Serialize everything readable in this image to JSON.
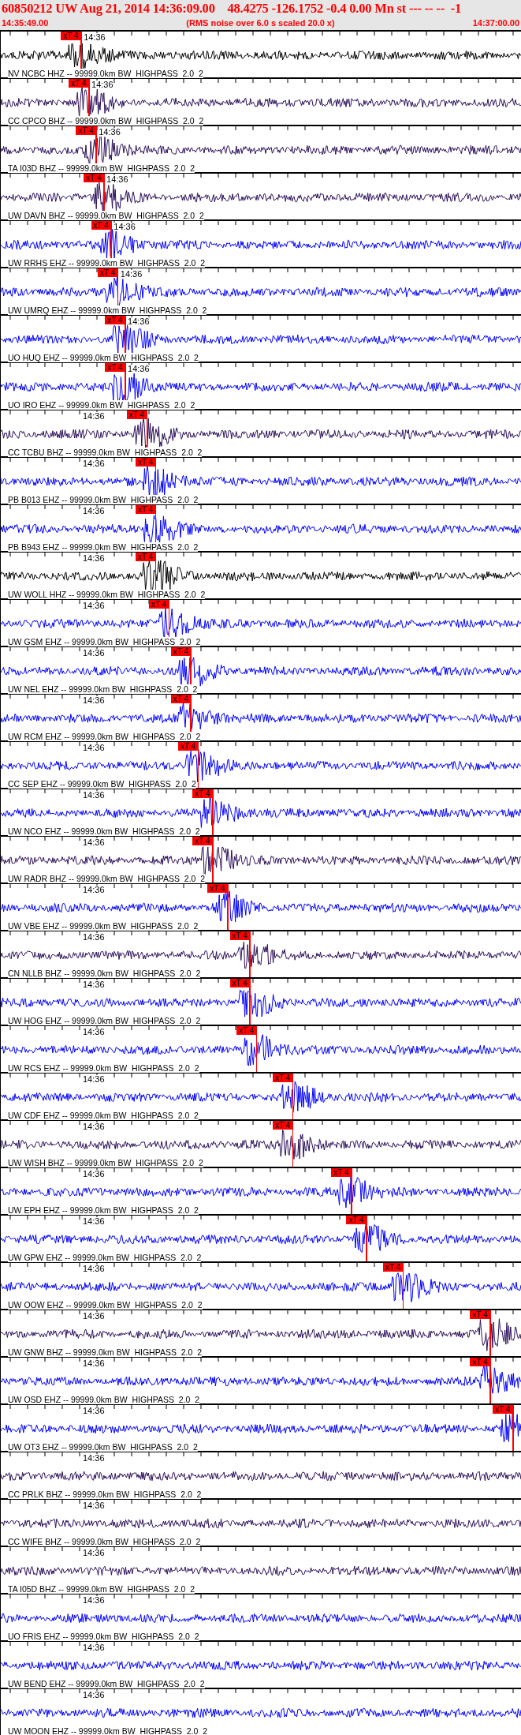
{
  "header": {
    "title": "60850212 UW Aug 21, 2014 14:36:09.00    48.4275 -126.1752 -0.4 0.00 Mn st --- -- --  -1",
    "start_time": "14:35:49.00",
    "note": "(RMS noise over 6.0 s scaled 20.0 x)",
    "end_time": "14:37:00.00"
  },
  "channels": [
    {
      "label": "NV NCBC HHZ -- 99999.0km BW  HIGHPASS  2.0  2",
      "time_label": "14:36",
      "color": "#000000",
      "pick": {
        "label": "xT 4",
        "level": 0.154
      }
    },
    {
      "label": "CC CPCO BHZ -- 99999.0km BW  HIGHPASS  2.0  2",
      "time_label": "14:36",
      "color": "#2b0f5a",
      "pick": {
        "label": "xT 4",
        "level": 0.169
      }
    },
    {
      "label": "TA I03D BHZ -- 99999.0km BW  HIGHPASS  2.0  2",
      "time_label": "14:36",
      "color": "#2b0f5a",
      "pick": {
        "label": "xT 4",
        "level": 0.183
      }
    },
    {
      "label": "UW DAVN BHZ -- 99999.0km BW  HIGHPASS  2.0  2",
      "time_label": "14:36",
      "color": "#2b0f5a",
      "pick": {
        "label": "xT 4",
        "level": 0.198
      }
    },
    {
      "label": "UW RRHS EHZ -- 99999.0km BW  HIGHPASS  2.0  2",
      "time_label": "14:36",
      "color": "#0000ff",
      "pick": {
        "label": "xT 4",
        "level": 0.212
      }
    },
    {
      "label": "UW UMRQ EHZ -- 99999.0km BW  HIGHPASS  2.0  2",
      "time_label": "14:36",
      "color": "#0000ff",
      "pick": {
        "label": "xT 4",
        "level": 0.225
      }
    },
    {
      "label": "UO HUQ EHZ -- 99999.0km BW  HIGHPASS  2.0  2",
      "time_label": "14:36",
      "color": "#0000ff",
      "pick": {
        "label": "xT 4",
        "level": 0.239
      }
    },
    {
      "label": "UO IRO EHZ -- 99999.0km BW  HIGHPASS  2.0  2",
      "time_label": "14:36",
      "color": "#0000ff",
      "pick": {
        "label": "xT 4",
        "level": 0.239
      }
    },
    {
      "label": "CC TCBU BHZ -- 99999.0km BW  HIGHPASS  2.0  2",
      "time_label": "14:36",
      "color": "#2b0f5a",
      "pick": {
        "label": "xT 4",
        "level": 0.281
      }
    },
    {
      "label": "PB B013 EHZ -- 99999.0km BW  HIGHPASS  2.0  2",
      "time_label": "14:36",
      "color": "#0000ff",
      "pick": {
        "label": "xT 4",
        "level": 0.298
      }
    },
    {
      "label": "PB B943 EHZ -- 99999.0km BW  HIGHPASS  2.0  2",
      "time_label": "14:36",
      "color": "#0000ff",
      "pick": {
        "label": "xT 4",
        "level": 0.298
      }
    },
    {
      "label": "UW WOLL HHZ -- 99999.0km BW  HIGHPASS  2.0  2",
      "time_label": "14:36",
      "color": "#000000",
      "pick": {
        "label": "xT 4",
        "level": 0.298
      }
    },
    {
      "label": "UW GSM EHZ -- 99999.0km BW  HIGHPASS  2.0  2",
      "time_label": "14:36",
      "color": "#0000ff",
      "pick": {
        "label": "xT 4",
        "level": 0.324
      }
    },
    {
      "label": "UW NEL EHZ -- 99999.0km BW  HIGHPASS  2.0  2",
      "time_label": "14:36",
      "color": "#0000ff",
      "pick": {
        "label": "xT 4",
        "level": 0.366
      }
    },
    {
      "label": "UW RCM EHZ -- 99999.0km BW  HIGHPASS  2.0  2",
      "time_label": "14:36",
      "color": "#0000ff",
      "pick": {
        "label": "xT 4",
        "level": 0.366
      }
    },
    {
      "label": "CC SEP EHZ -- 99999.0km BW  HIGHPASS  2.0  2",
      "time_label": "14:36",
      "color": "#0000ff",
      "pick": {
        "label": "xT 4",
        "level": 0.38
      }
    },
    {
      "label": "UW NCO EHZ -- 99999.0km BW  HIGHPASS  2.0  2",
      "time_label": "14:36",
      "color": "#0000ff",
      "pick": {
        "label": "xT 4",
        "level": 0.408
      }
    },
    {
      "label": "UW RADR BHZ -- 99999.0km BW  HIGHPASS  2.0  2",
      "time_label": "14:36",
      "color": "#2b0f5a",
      "pick": {
        "label": "xT 4",
        "level": 0.408
      }
    },
    {
      "label": "UW VBE EHZ -- 99999.0km BW  HIGHPASS  2.0  2",
      "time_label": "14:36",
      "color": "#0000ff",
      "pick": {
        "label": "xT 4",
        "level": 0.437
      }
    },
    {
      "label": "CN NLLB BHZ -- 99999.0km BW  HIGHPASS  2.0  2",
      "time_label": "14:36",
      "color": "#2b0f5a",
      "pick": {
        "label": "xT 4",
        "level": 0.48
      }
    },
    {
      "label": "UW HOG EHZ -- 99999.0km BW  HIGHPASS  2.0  2",
      "time_label": "14:36",
      "color": "#0000ff",
      "pick": {
        "label": "xT 4",
        "level": 0.48
      }
    },
    {
      "label": "UW RCS EHZ -- 99999.0km BW  HIGHPASS  2.0  2",
      "time_label": "14:36",
      "color": "#0000ff",
      "pick": {
        "label": "xT 4",
        "level": 0.493
      }
    },
    {
      "label": "UW CDF EHZ -- 99999.0km BW  HIGHPASS  2.0  2",
      "time_label": "14:36",
      "color": "#0000ff",
      "pick": {
        "label": "xT 4",
        "level": 0.563
      }
    },
    {
      "label": "UW WISH BHZ -- 99999.0km BW  HIGHPASS  2.0  2",
      "time_label": "14:36",
      "color": "#2b0f5a",
      "pick": {
        "label": "xT 4",
        "level": 0.563
      }
    },
    {
      "label": "UW EPH EHZ -- 99999.0km BW  HIGHPASS  2.0  2",
      "time_label": "14:36",
      "color": "#0000ff",
      "pick": {
        "label": "xT 4",
        "level": 0.676
      }
    },
    {
      "label": "UW GPW EHZ -- 99999.0km BW  HIGHPASS  2.0  2",
      "time_label": "14:36",
      "color": "#0000ff",
      "pick": {
        "label": "xT 4",
        "level": 0.705
      }
    },
    {
      "label": "UW OOW EHZ -- 99999.0km BW  HIGHPASS  2.0  2",
      "time_label": "14:36",
      "color": "#0000ff",
      "pick": {
        "label": "xT 4",
        "level": 0.776
      }
    },
    {
      "label": "UW GNW BHZ -- 99999.0km BW  HIGHPASS  2.0  2",
      "time_label": "14:36",
      "color": "#2b0f5a",
      "pick": {
        "label": "xT 4",
        "level": 0.944
      }
    },
    {
      "label": "UW OSD EHZ -- 99999.0km BW  HIGHPASS  2.0  2",
      "time_label": "14:36",
      "color": "#0000ff",
      "pick": {
        "label": "xT 4",
        "level": 0.944
      }
    },
    {
      "label": "UW OT3 EHZ -- 99999.0km BW  HIGHPASS  2.0  2",
      "time_label": "14:36",
      "color": "#0000ff",
      "pick": {
        "label": "xT 4",
        "level": 0.988
      }
    },
    {
      "label": "CC PRLK BHZ -- 99999.0km BW  HIGHPASS  2.0  2",
      "time_label": "14:36",
      "color": "#2b0f5a"
    },
    {
      "label": "CC WIFE BHZ -- 99999.0km BW  HIGHPASS  2.0  2",
      "time_label": "14:36",
      "color": "#2b0f5a"
    },
    {
      "label": "TA I05D BHZ -- 99999.0km BW  HIGHPASS  2.0  2",
      "time_label": "14:36",
      "color": "#2b0f5a"
    },
    {
      "label": "UO FRIS EHZ -- 99999.0km BW  HIGHPASS  2.0  2",
      "time_label": "14:36",
      "color": "#0000ff"
    },
    {
      "label": "UW BEND EHZ -- 99999.0km BW  HIGHPASS  2.0  2",
      "time_label": "14:36",
      "color": "#0000ff"
    },
    {
      "label": "UW MOON EHZ -- 99999.0km BW  HIGHPASS  2.0  2",
      "time_label": "14:36",
      "color": "#0000ff"
    }
  ]
}
